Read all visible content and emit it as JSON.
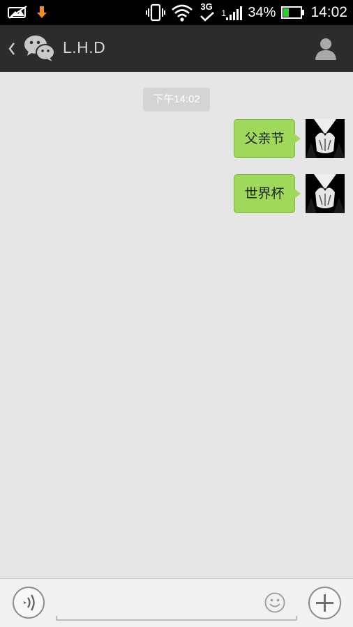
{
  "status_bar": {
    "battery_percent": "34%",
    "time": "14:02",
    "network_type": "3G",
    "signal_label": "1",
    "battery_level": 0.34,
    "battery_color": "#2ecc2e",
    "icons": [
      "photo-notification-icon",
      "download-icon",
      "vibrate-icon",
      "wifi-icon",
      "network-3g-icon",
      "signal-icon",
      "battery-icon"
    ]
  },
  "header": {
    "back_icon": "chevron-left-icon",
    "app_icon": "wechat-icon",
    "contact_name": "L.H.D",
    "profile_icon": "person-icon"
  },
  "chat": {
    "timestamp": "下午14:02",
    "messages": [
      {
        "text": "父亲节",
        "sender": "me"
      },
      {
        "text": "世界杯",
        "sender": "me"
      }
    ],
    "bubble_color": "#9fd95b"
  },
  "input_bar": {
    "voice_icon": "voice-icon",
    "emoji_icon": "emoji-icon",
    "plus_icon": "plus-icon",
    "text_value": ""
  }
}
